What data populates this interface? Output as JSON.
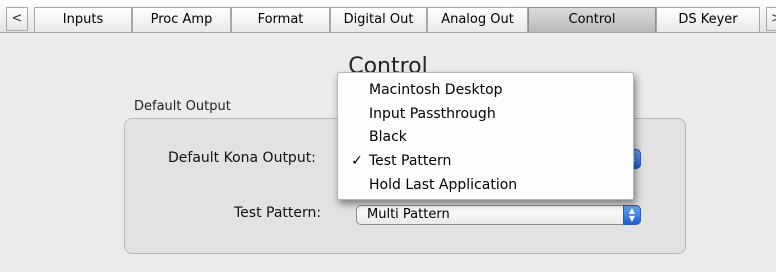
{
  "tabs": {
    "scroll_left": "<",
    "scroll_right": ">",
    "items": [
      {
        "label": "Inputs"
      },
      {
        "label": "Proc Amp"
      },
      {
        "label": "Format"
      },
      {
        "label": "Digital Out"
      },
      {
        "label": "Analog Out"
      },
      {
        "label": "Control",
        "selected": true
      },
      {
        "label": "DS Keyer"
      }
    ]
  },
  "page": {
    "title": "Control"
  },
  "default_output": {
    "group_label": "Default Output",
    "kona_output_label": "Default Kona Output:",
    "test_pattern_label": "Test Pattern:",
    "test_pattern_value": "Multi Pattern"
  },
  "menu": {
    "check_mark": "✓",
    "items": [
      {
        "label": "Macintosh Desktop",
        "checked": false
      },
      {
        "label": "Input Passthrough",
        "checked": false
      },
      {
        "label": "Black",
        "checked": false
      },
      {
        "label": "Test Pattern",
        "checked": true
      },
      {
        "label": "Hold Last Application",
        "checked": false
      }
    ]
  },
  "icons": {
    "popup_arrows": "updown-arrows-icon"
  },
  "colors": {
    "popup_arrow_blue": "#1d5fd1",
    "selected_tab": "#b8b8b8"
  }
}
